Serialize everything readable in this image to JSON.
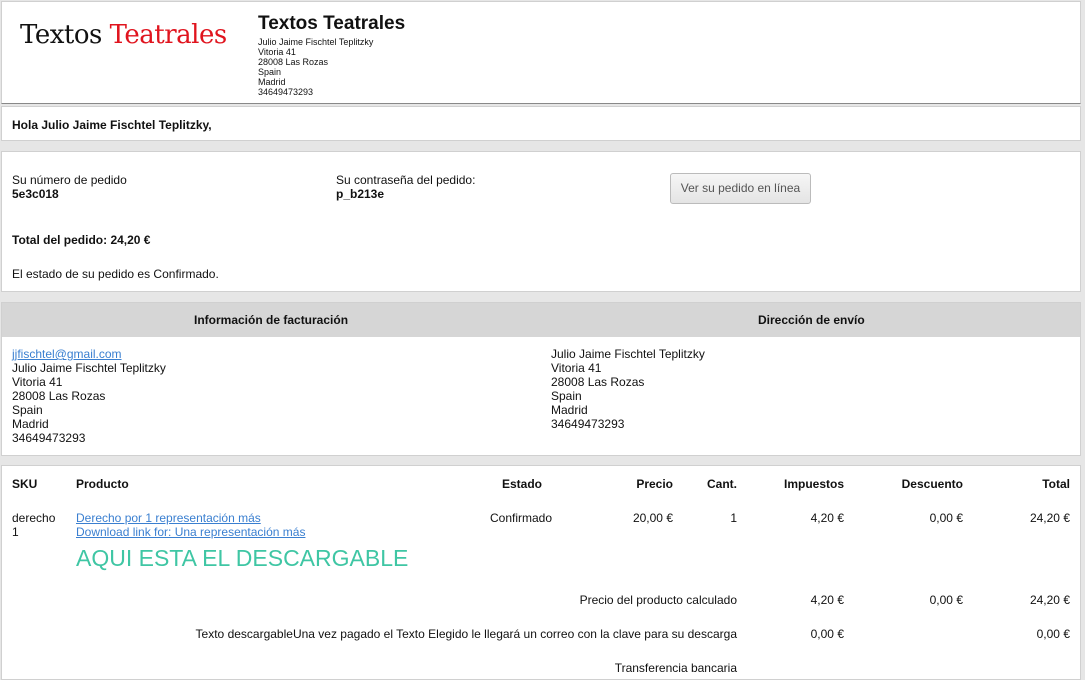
{
  "header": {
    "logo_word1": "Textos",
    "logo_word2": "Teatrales",
    "shop_name": "Textos Teatrales",
    "shop_lines": [
      "Julio Jaime Fischtel Teplitzky",
      "Vitoria 41",
      "28008 Las Rozas",
      "Spain",
      "Madrid",
      "34649473293"
    ]
  },
  "greeting": "Hola Julio Jaime Fischtel Teplitzky,",
  "order": {
    "number_label": "Su número de pedido",
    "number_value": "5e3c018",
    "password_label": "Su contraseña del pedido:",
    "password_value": "p_b213e",
    "view_button": "Ver su pedido en línea",
    "total": "Total del pedido: 24,20 €",
    "status": "El estado de su pedido es Confirmado."
  },
  "addresses": {
    "billing_title": "Información de facturación",
    "shipping_title": "Dirección de envío",
    "billing_email": "jjfischtel@gmail.com",
    "billing_lines": [
      "Julio Jaime Fischtel Teplitzky",
      "Vitoria 41",
      "28008 Las Rozas",
      "Spain",
      "Madrid",
      "34649473293"
    ],
    "shipping_lines": [
      "Julio Jaime Fischtel Teplitzky",
      "Vitoria 41",
      "28008 Las Rozas",
      "Spain",
      "Madrid",
      "34649473293"
    ]
  },
  "items": {
    "headers": {
      "sku": "SKU",
      "product": "Producto",
      "status": "Estado",
      "price": "Precio",
      "qty": "Cant.",
      "tax": "Impuestos",
      "discount": "Descuento",
      "total": "Total"
    },
    "row": {
      "sku_line1": "derecho",
      "sku_line2": "1",
      "product_link": "Derecho por 1 representación más",
      "download_link": "Download link for: Una representación más",
      "status": "Confirmado",
      "price": "20,00 €",
      "qty": "1",
      "tax": "4,20 €",
      "discount": "0,00 €",
      "total": "24,20 €"
    },
    "download_note": "AQUI ESTA EL DESCARGABLE",
    "summary": [
      {
        "label": "Precio del producto calculado",
        "tax": "4,20 €",
        "discount": "0,00 €",
        "total": "24,20 €"
      },
      {
        "label": "Texto descargableUna vez pagado el Texto Elegido le llegará un correo con la clave para su descarga",
        "tax": "0,00 €",
        "discount": "",
        "total": "0,00 €"
      },
      {
        "label": "Transferencia bancaria",
        "tax": "",
        "discount": "",
        "total": ""
      }
    ]
  },
  "colors": {
    "logo_red": "#e0141e",
    "link": "#3a7fd0",
    "download_note": "#3fc6a4"
  }
}
